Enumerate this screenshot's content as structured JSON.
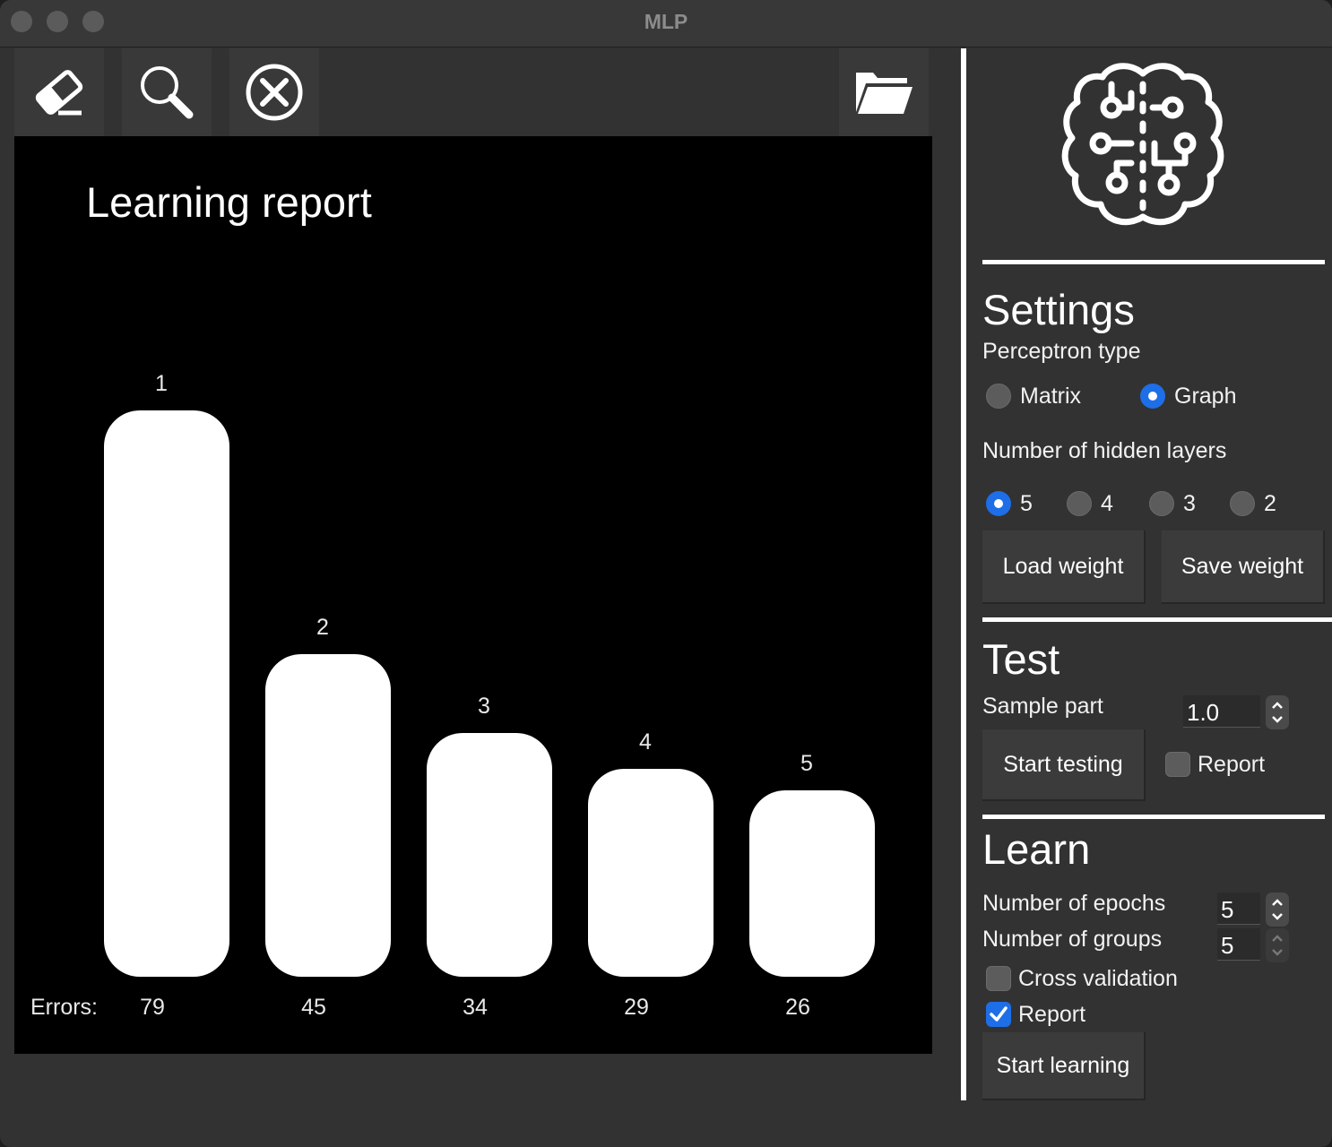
{
  "window": {
    "title": "MLP"
  },
  "toolbar": {
    "buttons": [
      {
        "icon": "eraser-icon"
      },
      {
        "icon": "magnifier-icon"
      },
      {
        "icon": "close-circle-icon"
      },
      {
        "icon": "folder-icon"
      }
    ]
  },
  "report": {
    "title": "Learning report",
    "errors_label": "Errors:"
  },
  "chart_data": {
    "type": "bar",
    "title": "Learning report",
    "categories": [
      "1",
      "2",
      "3",
      "4",
      "5"
    ],
    "values": [
      79,
      45,
      34,
      29,
      26
    ],
    "value_label": "Errors:",
    "bar_color": "#ffffff",
    "background": "#000000"
  },
  "settings": {
    "heading": "Settings",
    "perceptron_type_label": "Perceptron type",
    "perceptron_types": [
      {
        "label": "Matrix",
        "selected": false
      },
      {
        "label": "Graph",
        "selected": true
      }
    ],
    "hidden_layers_label": "Number of hidden layers",
    "hidden_layers": [
      {
        "label": "5",
        "selected": true
      },
      {
        "label": "4",
        "selected": false
      },
      {
        "label": "3",
        "selected": false
      },
      {
        "label": "2",
        "selected": false
      }
    ],
    "load_weight": "Load weight",
    "save_weight": "Save weight"
  },
  "test": {
    "heading": "Test",
    "sample_part_label": "Sample part",
    "sample_part_value": "1.0",
    "start_testing": "Start testing",
    "report_label": "Report",
    "report_checked": false
  },
  "learn": {
    "heading": "Learn",
    "epochs_label": "Number of epochs",
    "epochs_value": "5",
    "groups_label": "Number of groups",
    "groups_value": "5",
    "cross_validation_label": "Cross validation",
    "cross_validation_checked": false,
    "report_label": "Report",
    "report_checked": true,
    "start_learning": "Start learning"
  },
  "colors": {
    "accent": "#1e6ee8",
    "panel": "#323232",
    "canvas": "#000000"
  }
}
